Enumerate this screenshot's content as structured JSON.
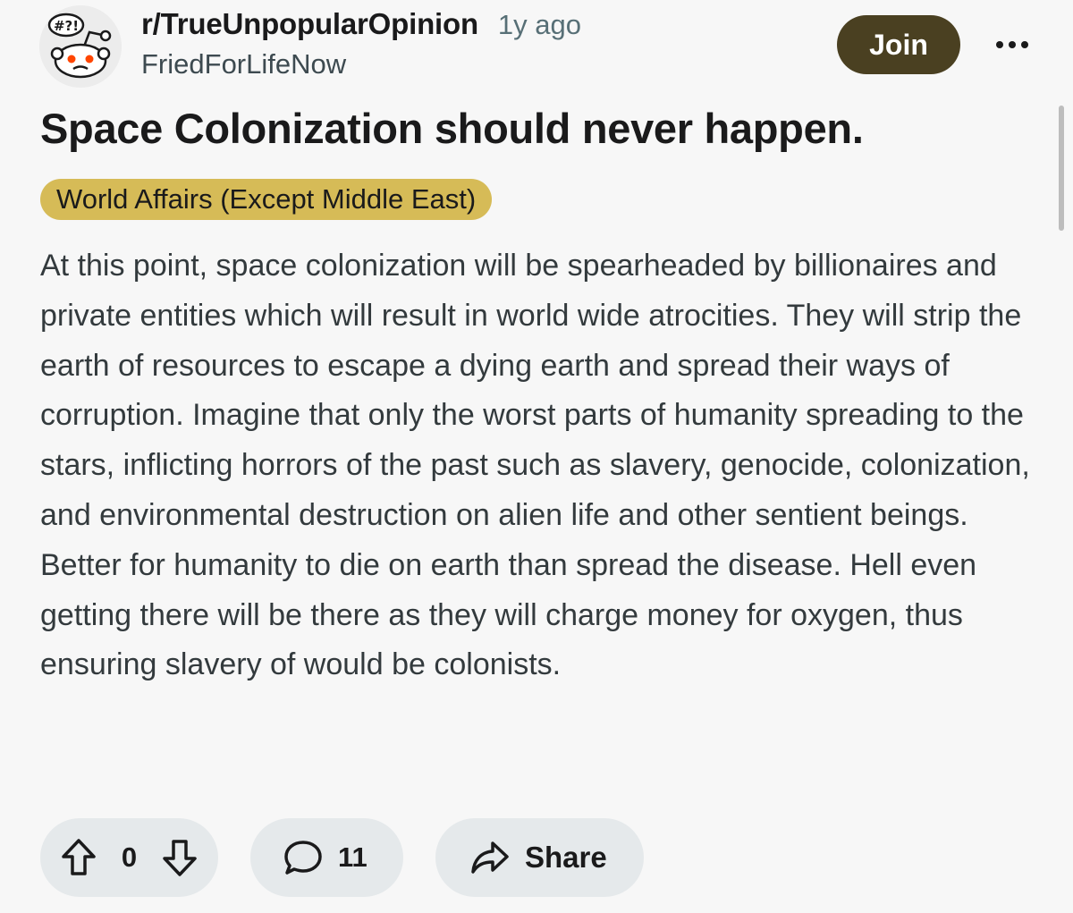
{
  "post": {
    "subreddit": "r/TrueUnpopularOpinion",
    "time_ago": "1y ago",
    "author": "FriedForLifeNow",
    "join_label": "Join",
    "title": "Space Colonization should never happen.",
    "flair": "World Affairs (Except Middle East)",
    "body": "At this point, space colonization will be spearheaded by billionaires and private entities which will result in world wide atrocities. They will strip the earth of resources to escape a dying earth and spread their ways of corruption. Imagine that only the worst parts of humanity spreading to the stars, inflicting horrors of the past such as slavery, genocide, colonization, and environmental destruction on alien life and other sentient beings. Better for humanity to die on earth than spread the disease. Hell even getting there will be there as they will charge money for oxygen, thus ensuring slavery of would be colonists."
  },
  "avatar": {
    "speech_bubble_text": "#?!"
  },
  "actions": {
    "vote_count": "0",
    "comment_count": "11",
    "share_label": "Share"
  },
  "colors": {
    "join_bg": "#4a4021",
    "flair_bg": "#d6bb57",
    "pill_bg": "#e5e9eb",
    "background": "#f7f7f7",
    "snoo_accent": "#ff4500"
  },
  "icons": [
    "subreddit-avatar-snoo",
    "more-options-icon",
    "upvote-icon",
    "downvote-icon",
    "comment-icon",
    "share-icon"
  ]
}
